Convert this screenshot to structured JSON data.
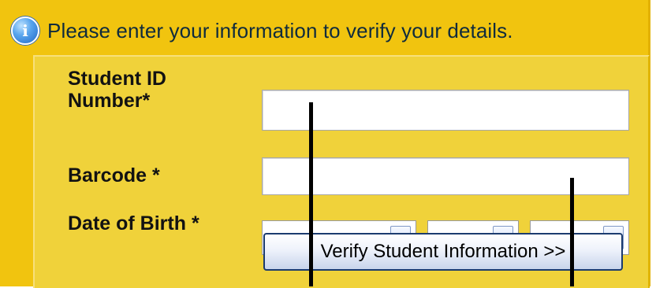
{
  "header": {
    "icon": "info-icon",
    "text": "Please enter your information to verify your details."
  },
  "form": {
    "student_id": {
      "label": "Student ID\nNumber*",
      "value": ""
    },
    "barcode": {
      "label": "Barcode *",
      "value": ""
    },
    "dob": {
      "label": "Date of Birth *",
      "month_value": "---------",
      "day_value": "--",
      "year_value": "----"
    },
    "verify_button_label": "Verify Student Information >>"
  },
  "colors": {
    "panel_background": "#f1c40f",
    "form_background": "#f0d23a",
    "button_border": "#1b3b6f"
  }
}
